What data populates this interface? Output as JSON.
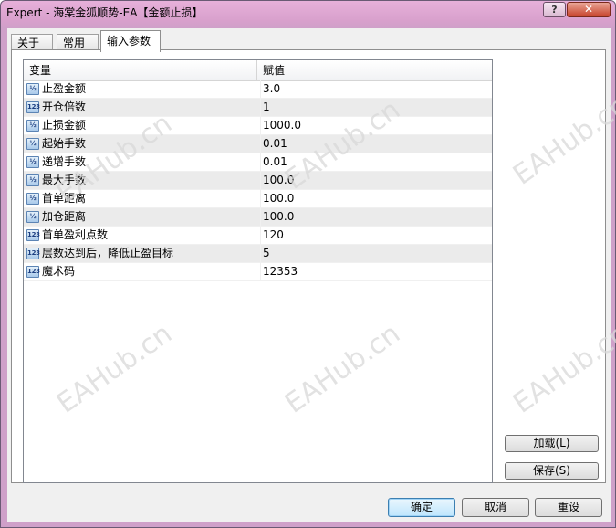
{
  "window": {
    "title": "Expert - 海棠金狐顺势-EA【金额止损】",
    "help_label": "?",
    "close_label": "✕"
  },
  "tabs": [
    {
      "label": "关于",
      "active": false
    },
    {
      "label": "常用",
      "active": false
    },
    {
      "label": "输入参数",
      "active": true
    }
  ],
  "grid": {
    "headers": {
      "variable": "变量",
      "value": "赋值"
    },
    "rows": [
      {
        "icon": "½",
        "type": "double-type-icon",
        "name": "止盈金额",
        "value": "3.0"
      },
      {
        "icon": "123",
        "type": "integer-type-icon",
        "name": "开仓倍数",
        "value": "1"
      },
      {
        "icon": "½",
        "type": "double-type-icon",
        "name": "止损金额",
        "value": "1000.0"
      },
      {
        "icon": "½",
        "type": "double-type-icon",
        "name": "起始手数",
        "value": "0.01"
      },
      {
        "icon": "½",
        "type": "double-type-icon",
        "name": "递增手数",
        "value": "0.01"
      },
      {
        "icon": "½",
        "type": "double-type-icon",
        "name": "最大手数",
        "value": "100.0"
      },
      {
        "icon": "½",
        "type": "double-type-icon",
        "name": "首单距离",
        "value": "100.0"
      },
      {
        "icon": "½",
        "type": "double-type-icon",
        "name": "加仓距离",
        "value": "100.0"
      },
      {
        "icon": "123",
        "type": "integer-type-icon",
        "name": "首单盈利点数",
        "value": "120"
      },
      {
        "icon": "123",
        "type": "integer-type-icon",
        "name": "层数达到后，降低止盈目标",
        "value": "5"
      },
      {
        "icon": "123",
        "type": "integer-type-icon",
        "name": "魔术码",
        "value": "12353"
      }
    ]
  },
  "side_buttons": {
    "load": "加载(L)",
    "save": "保存(S)"
  },
  "bottom_buttons": {
    "ok": "确定",
    "cancel": "取消",
    "reset": "重设"
  },
  "watermark": "EAHub.cn"
}
